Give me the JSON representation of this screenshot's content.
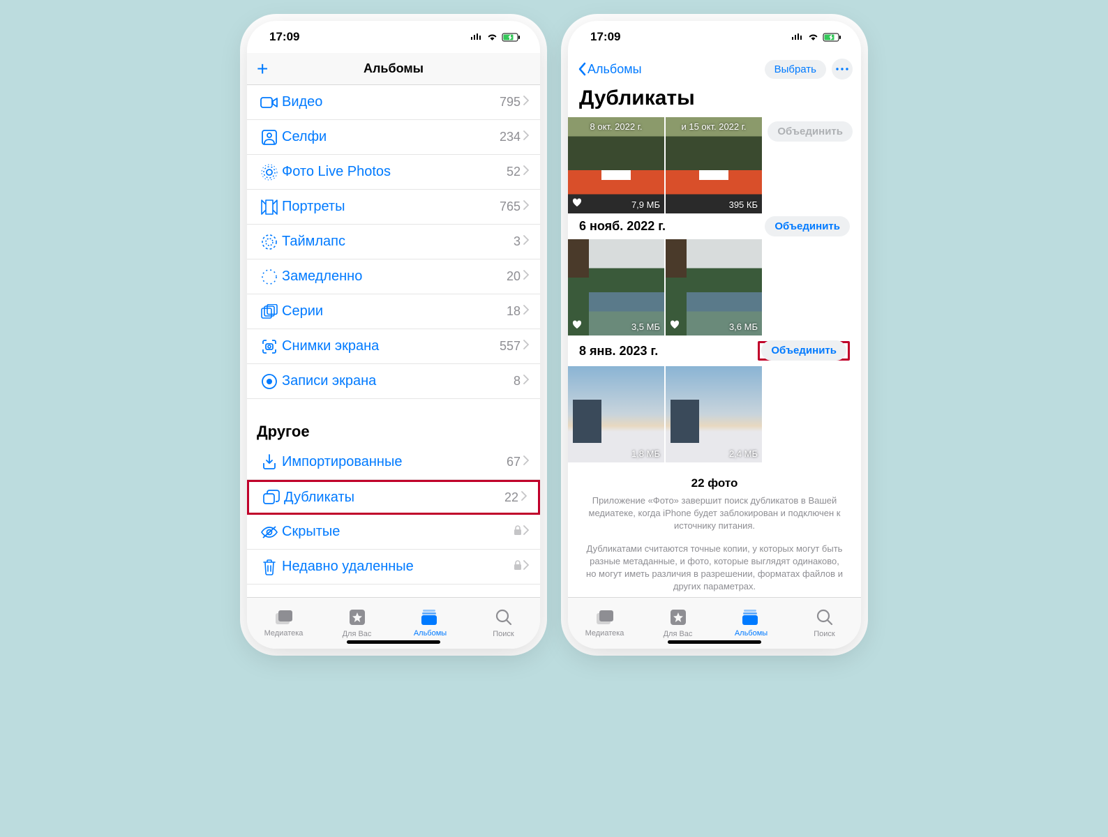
{
  "status": {
    "time": "17:09"
  },
  "screen1": {
    "nav_title": "Альбомы",
    "rows": [
      {
        "icon": "video",
        "label": "Видео",
        "count": "795"
      },
      {
        "icon": "selfie",
        "label": "Селфи",
        "count": "234"
      },
      {
        "icon": "live",
        "label": "Фото Live Photos",
        "count": "52"
      },
      {
        "icon": "portrait",
        "label": "Портреты",
        "count": "765"
      },
      {
        "icon": "timelapse",
        "label": "Таймлапс",
        "count": "3"
      },
      {
        "icon": "slowmo",
        "label": "Замедленно",
        "count": "20"
      },
      {
        "icon": "burst",
        "label": "Серии",
        "count": "18"
      },
      {
        "icon": "screenshot",
        "label": "Снимки экрана",
        "count": "557"
      },
      {
        "icon": "screenrec",
        "label": "Записи экрана",
        "count": "8"
      }
    ],
    "other_header": "Другое",
    "other_rows": [
      {
        "icon": "import",
        "label": "Импортированные",
        "count": "67",
        "lock": false
      },
      {
        "icon": "duplicates",
        "label": "Дубликаты",
        "count": "22",
        "lock": false,
        "highlight": true
      },
      {
        "icon": "hidden",
        "label": "Скрытые",
        "count": "",
        "lock": true
      },
      {
        "icon": "trash",
        "label": "Недавно удаленные",
        "count": "",
        "lock": true
      }
    ]
  },
  "screen2": {
    "back_label": "Альбомы",
    "select_label": "Выбрать",
    "title": "Дубликаты",
    "groups": [
      {
        "date_header": "",
        "merge": "Объединить",
        "merge_disabled": true,
        "header_visible": false,
        "thumbs": [
          {
            "art": "train",
            "overlay_date": "8 окт. 2022 г.",
            "heart": true,
            "size": "7,9 МБ"
          },
          {
            "art": "train",
            "overlay_date": "и 15 окт. 2022 г.",
            "heart": false,
            "size": "395 КБ"
          }
        ]
      },
      {
        "date_header": "6 нояб. 2022 г.",
        "merge": "Объединить",
        "merge_disabled": false,
        "header_visible": true,
        "thumbs": [
          {
            "art": "park",
            "heart": true,
            "size": "3,5 МБ"
          },
          {
            "art": "park",
            "heart": true,
            "size": "3,6 МБ"
          }
        ]
      },
      {
        "date_header": "8 янв. 2023 г.",
        "merge": "Объединить",
        "merge_disabled": false,
        "header_visible": true,
        "highlight_merge": true,
        "thumbs": [
          {
            "art": "city",
            "heart": false,
            "size": "1,8 МБ"
          },
          {
            "art": "city",
            "heart": false,
            "size": "2,4 МБ"
          }
        ]
      }
    ],
    "info_title": "22 фото",
    "info_p1": "Приложение «Фото» завершит поиск дубликатов в Вашей медиатеке, когда iPhone будет заблокирован и подключен к источнику питания.",
    "info_p2": "Дубликатами считаются точные копии, у которых могут быть разные метаданные, и фото, которые выглядят одинаково, но могут иметь различия в разрешении, форматах файлов и других параметрах."
  },
  "tabs": {
    "library": "Медиатека",
    "foryou": "Для Вас",
    "albums": "Альбомы",
    "search": "Поиск"
  }
}
